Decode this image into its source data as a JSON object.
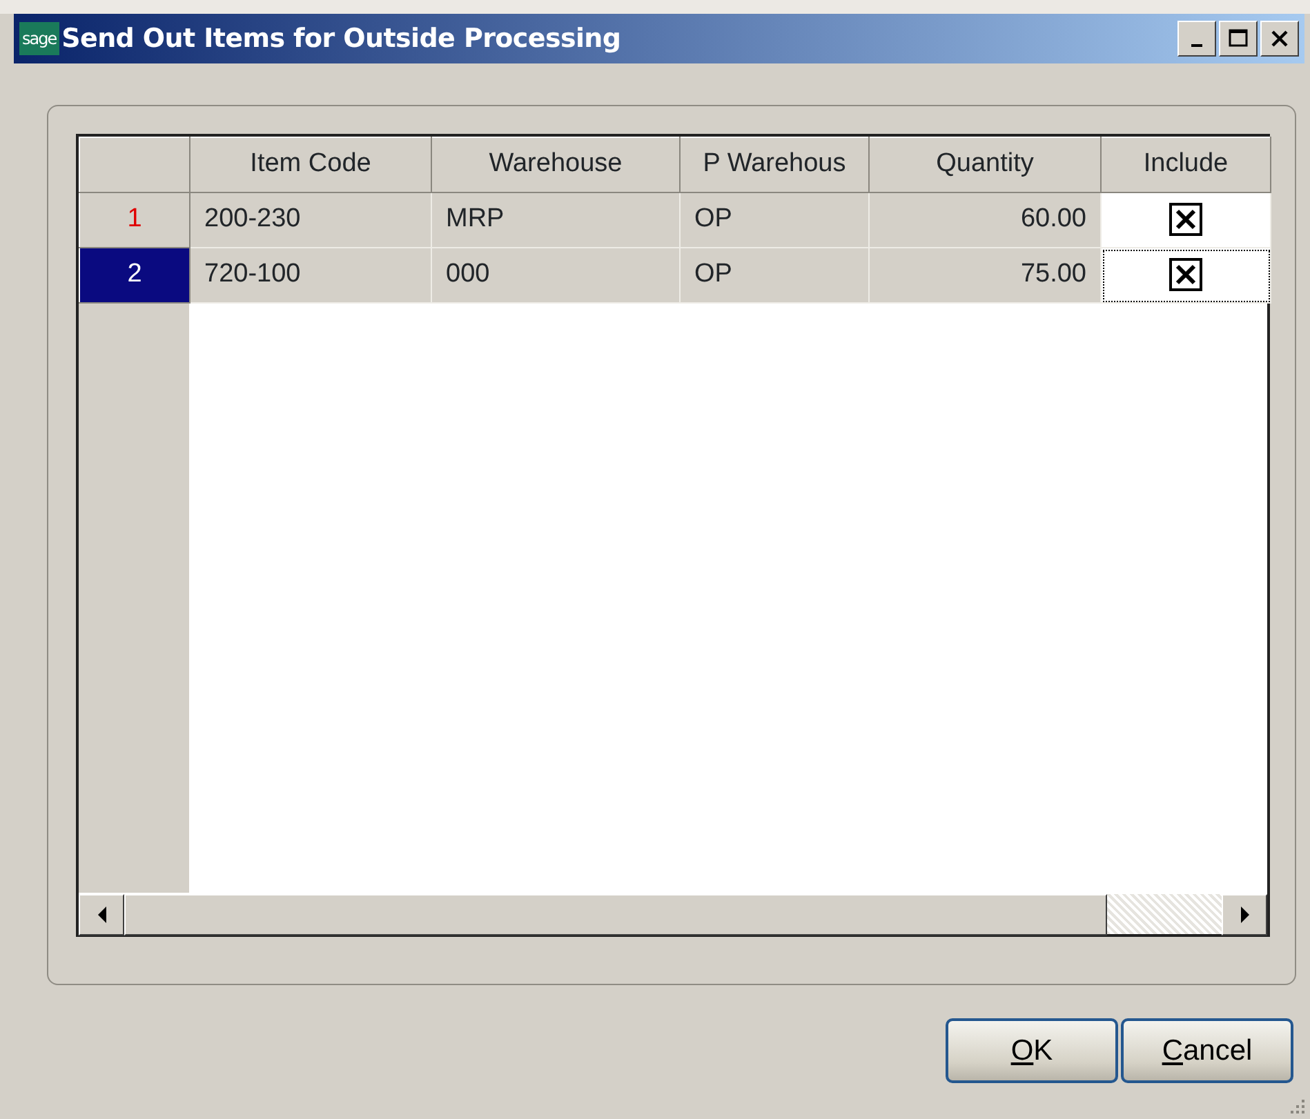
{
  "window": {
    "logo": "sage",
    "title": "Send Out Items for Outside Processing"
  },
  "table": {
    "columns": [
      "Item Code",
      "Warehouse",
      "P Warehous",
      "Quantity",
      "Include"
    ],
    "rows": [
      {
        "number": "1",
        "selected": false,
        "item_code": "200-230",
        "warehouse": "MRP",
        "op_warehouse": "OP",
        "quantity": "60.00",
        "include": true,
        "focused": false
      },
      {
        "number": "2",
        "selected": true,
        "item_code": "720-100",
        "warehouse": "000",
        "op_warehouse": "OP",
        "quantity": "75.00",
        "include": true,
        "focused": true
      }
    ]
  },
  "buttons": [
    "OK",
    "Cancel"
  ]
}
